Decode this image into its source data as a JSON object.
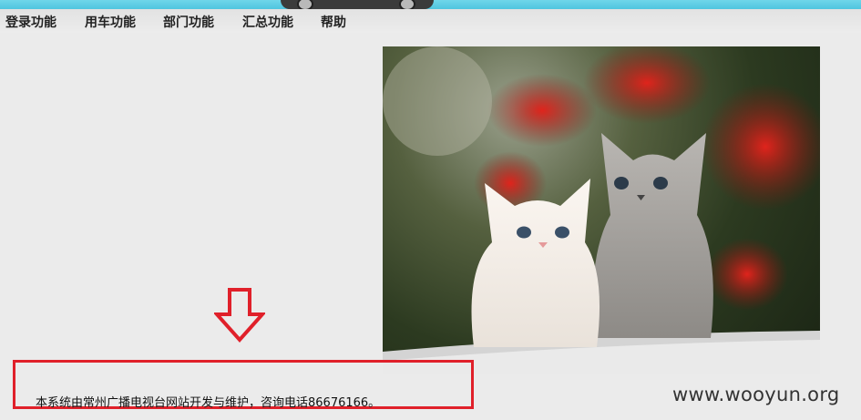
{
  "nav": {
    "items": [
      "登录功能",
      "用车功能",
      "部门功能",
      "汇总功能",
      "帮助"
    ]
  },
  "footer": {
    "notice": "本系统由常州广播电视台网站开发与维护，咨询电话86676166。"
  },
  "watermark": "www.wooyun.org",
  "colors": {
    "banner": "#4fc5df",
    "highlight": "#e0202a",
    "background": "#ebebeb"
  },
  "icons": [
    "car-illustration",
    "down-arrow-icon",
    "kittens-photo"
  ]
}
